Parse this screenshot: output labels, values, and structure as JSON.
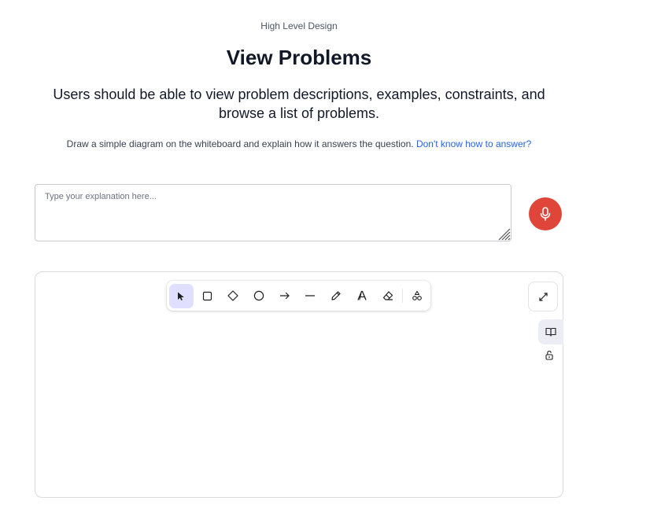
{
  "header": {
    "eyebrow": "High Level Design",
    "title": "View Problems",
    "question": "Users should be able to view problem descriptions, examples, constraints, and browse a list of problems."
  },
  "instructions": {
    "text": "Draw a simple diagram on the whiteboard and explain how it answers the question.",
    "help_link": "Don't know how to answer?"
  },
  "explanation": {
    "placeholder": "Type your explanation here...",
    "value": ""
  },
  "colors": {
    "mic_button": "#e0453a",
    "link": "#2563eb",
    "active_tool": "#e0dfff"
  },
  "whiteboard": {
    "tools": [
      {
        "name": "selection",
        "icon": "pointer-icon",
        "active": true
      },
      {
        "name": "rectangle",
        "icon": "rectangle-icon",
        "active": false
      },
      {
        "name": "diamond",
        "icon": "diamond-icon",
        "active": false
      },
      {
        "name": "ellipse",
        "icon": "circle-icon",
        "active": false
      },
      {
        "name": "arrow",
        "icon": "arrow-icon",
        "active": false
      },
      {
        "name": "line",
        "icon": "line-icon",
        "active": false
      },
      {
        "name": "draw",
        "icon": "pencil-icon",
        "active": false
      },
      {
        "name": "text",
        "icon": "text-icon",
        "active": false
      },
      {
        "name": "eraser",
        "icon": "eraser-icon",
        "active": false
      },
      {
        "name": "shapes",
        "icon": "shapes-icon",
        "active": false
      }
    ],
    "side_icons": [
      "expand-icon",
      "book-icon",
      "lock-icon"
    ]
  }
}
